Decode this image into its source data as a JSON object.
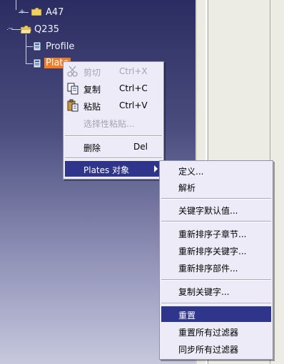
{
  "tree": {
    "items": [
      {
        "label": "A47"
      },
      {
        "label": "Q235"
      },
      {
        "label": "Profile"
      },
      {
        "label": "Plate"
      }
    ]
  },
  "context_menu": {
    "items": [
      {
        "label": "剪切",
        "shortcut": "Ctrl+X",
        "enabled": false,
        "icon": "scissors-icon"
      },
      {
        "label": "复制",
        "shortcut": "Ctrl+C",
        "enabled": true,
        "icon": "copy-icon"
      },
      {
        "label": "粘贴",
        "shortcut": "Ctrl+V",
        "enabled": true,
        "icon": "paste-icon"
      },
      {
        "label": "选择性粘贴...",
        "enabled": false
      },
      {
        "label": "删除",
        "shortcut": "Del",
        "enabled": true
      },
      {
        "label": "Plates 对象",
        "submenu": true,
        "highlighted": true
      }
    ]
  },
  "submenu": {
    "items": [
      {
        "label": "定义..."
      },
      {
        "label": "解析"
      },
      {
        "label": "关键字默认值..."
      },
      {
        "label": "重新排序子章节..."
      },
      {
        "label": "重新排序关键字..."
      },
      {
        "label": "重新排序部件..."
      },
      {
        "label": "复制关键字..."
      },
      {
        "label": "重置",
        "highlighted": true
      },
      {
        "label": "重置所有过滤器"
      },
      {
        "label": "同步所有过滤器"
      }
    ]
  },
  "colors": {
    "highlight": "#30358c",
    "selection": "#f47b21",
    "menu_bg": "#ecebf7"
  }
}
